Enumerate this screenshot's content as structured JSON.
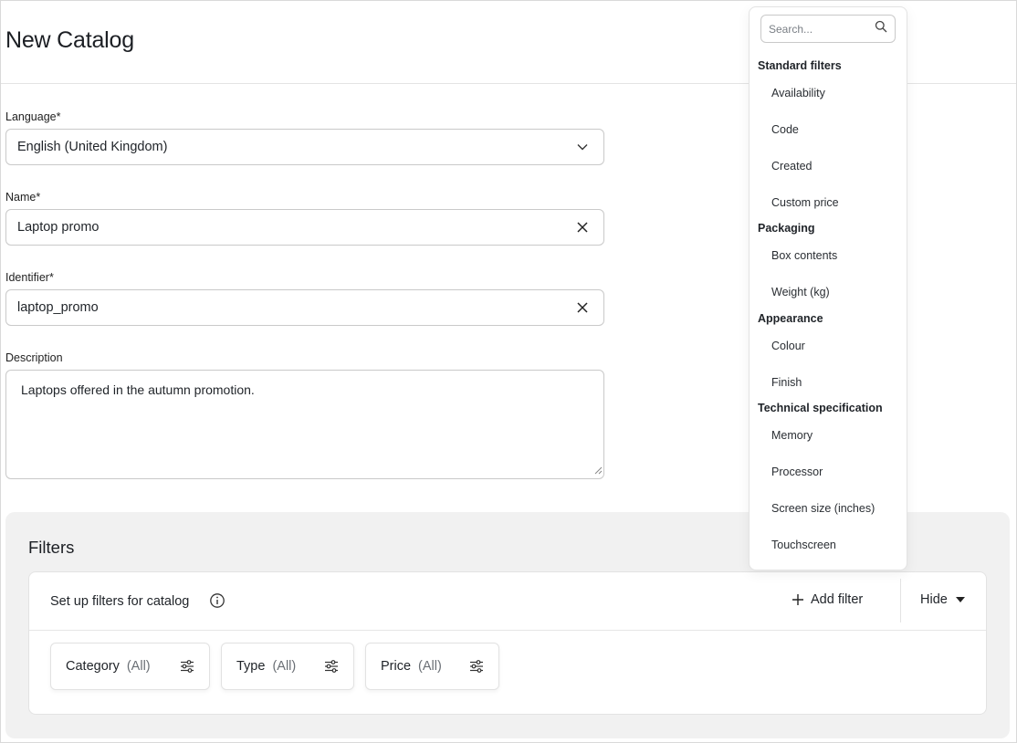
{
  "page": {
    "title": "New Catalog"
  },
  "form": {
    "language": {
      "label": "Language*",
      "value": "English (United Kingdom)"
    },
    "name": {
      "label": "Name*",
      "value": "Laptop promo"
    },
    "identifier": {
      "label": "Identifier*",
      "value": "laptop_promo"
    },
    "description": {
      "label": "Description",
      "value": "Laptops offered in the autumn promotion."
    }
  },
  "filters": {
    "title": "Filters",
    "setup_label": "Set up filters for catalog",
    "add_filter_label": "Add filter",
    "hide_label": "Hide",
    "chips": [
      {
        "name": "Category",
        "value": "(All)"
      },
      {
        "name": "Type",
        "value": "(All)"
      },
      {
        "name": "Price",
        "value": "(All)"
      }
    ]
  },
  "dropdown": {
    "search_placeholder": "Search...",
    "groups": [
      {
        "title": "Standard filters",
        "items": [
          "Availability",
          "Code",
          "Created",
          "Custom price"
        ]
      },
      {
        "title": "Packaging",
        "items": [
          "Box contents",
          "Weight (kg)"
        ]
      },
      {
        "title": "Appearance",
        "items": [
          "Colour",
          "Finish"
        ]
      },
      {
        "title": "Technical specification",
        "items": [
          "Memory",
          "Processor",
          "Screen size (inches)",
          "Touchscreen"
        ]
      }
    ]
  }
}
